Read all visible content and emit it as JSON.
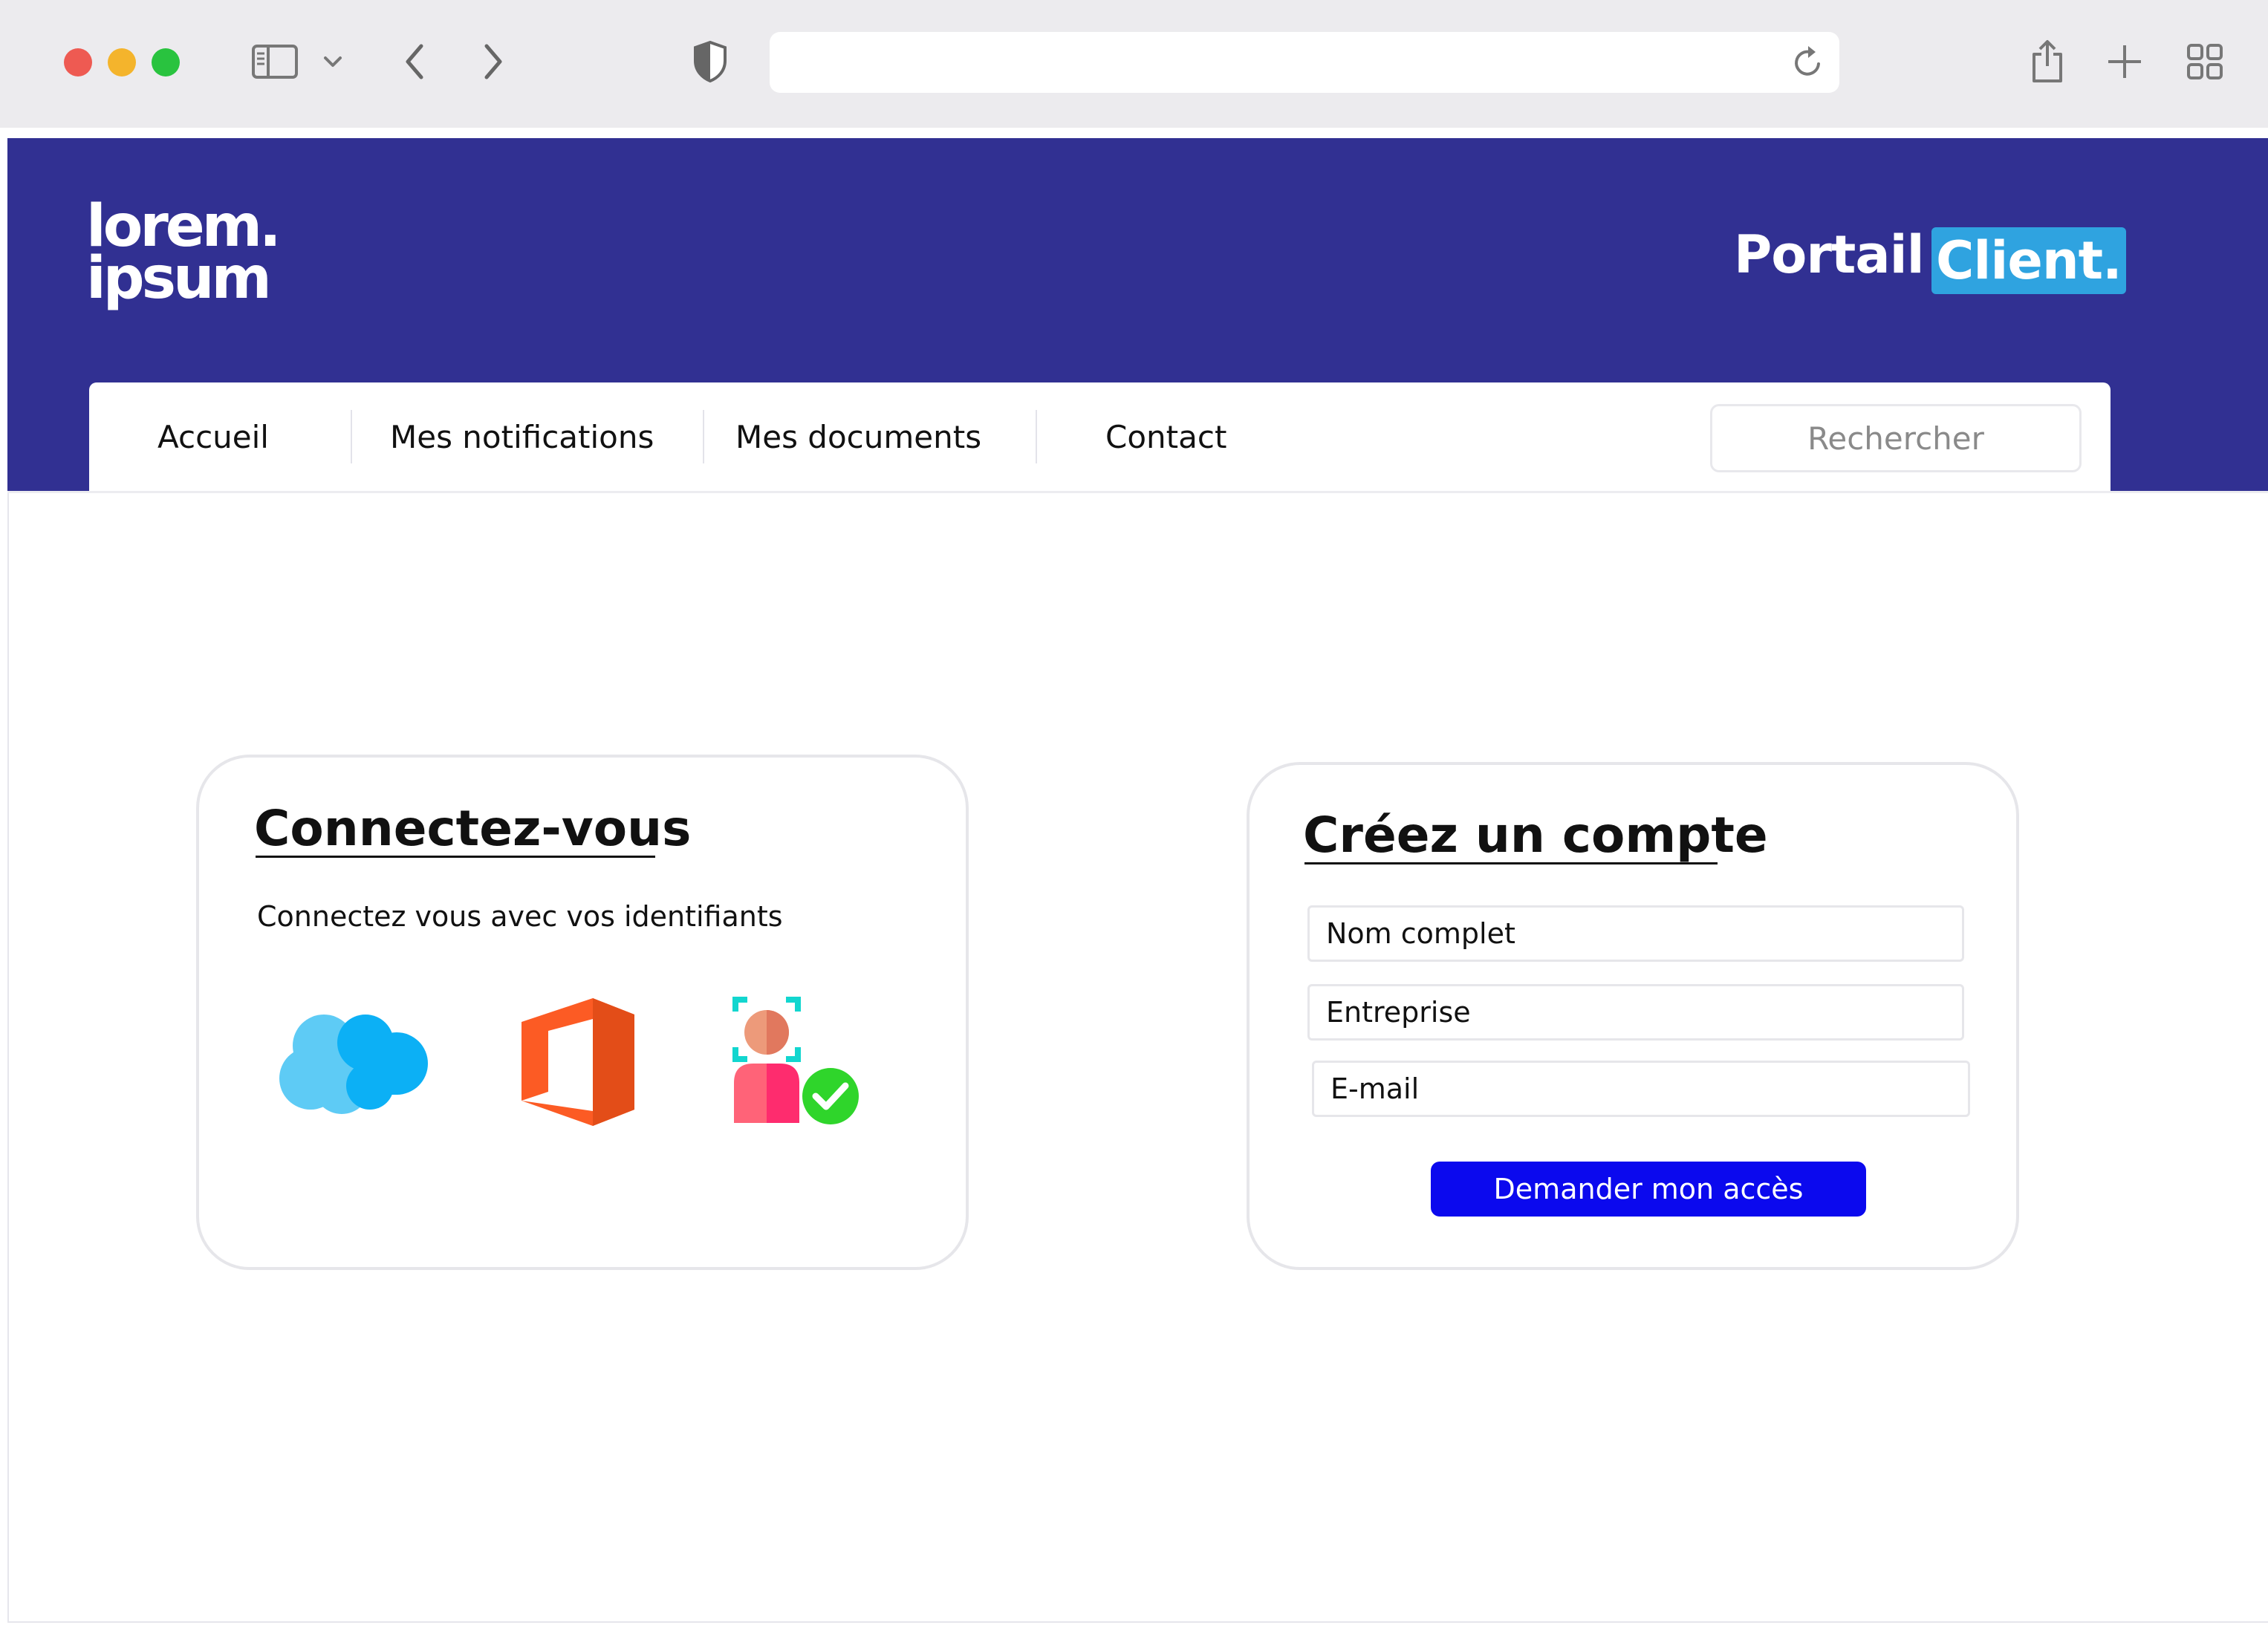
{
  "browser": {
    "traffic_lights": {
      "close_color": "#ee5a52",
      "minimize_color": "#f4b42c",
      "zoom_color": "#29c33f"
    },
    "icons": [
      "sidebar-icon",
      "chevron-down-icon",
      "back-icon",
      "forward-icon",
      "privacy-shield-icon",
      "reload-icon",
      "share-icon",
      "new-tab-icon",
      "tab-overview-icon"
    ],
    "address_value": ""
  },
  "header": {
    "logo_line1": "lorem.",
    "logo_line2": "ipsum",
    "portal_word": "Portail",
    "portal_highlight": "Client.",
    "bg_color": "#313092",
    "highlight_color": "#2fa3e0"
  },
  "nav": {
    "items": [
      "Accueil",
      "Mes notifications",
      "Mes documents",
      "Contact"
    ],
    "search_placeholder": "Rechercher"
  },
  "login_card": {
    "title": "Connectez-vous",
    "subtitle": "Connectez vous avec vos identifiants",
    "providers": [
      "salesforce-cloud-icon",
      "office-icon",
      "face-id-verified-icon"
    ]
  },
  "signup_card": {
    "title": "Créez un compte",
    "fields": [
      "Nom complet",
      "Entreprise",
      "E-mail"
    ],
    "submit_label": "Demander mon accès",
    "button_color": "#0b09ee"
  }
}
